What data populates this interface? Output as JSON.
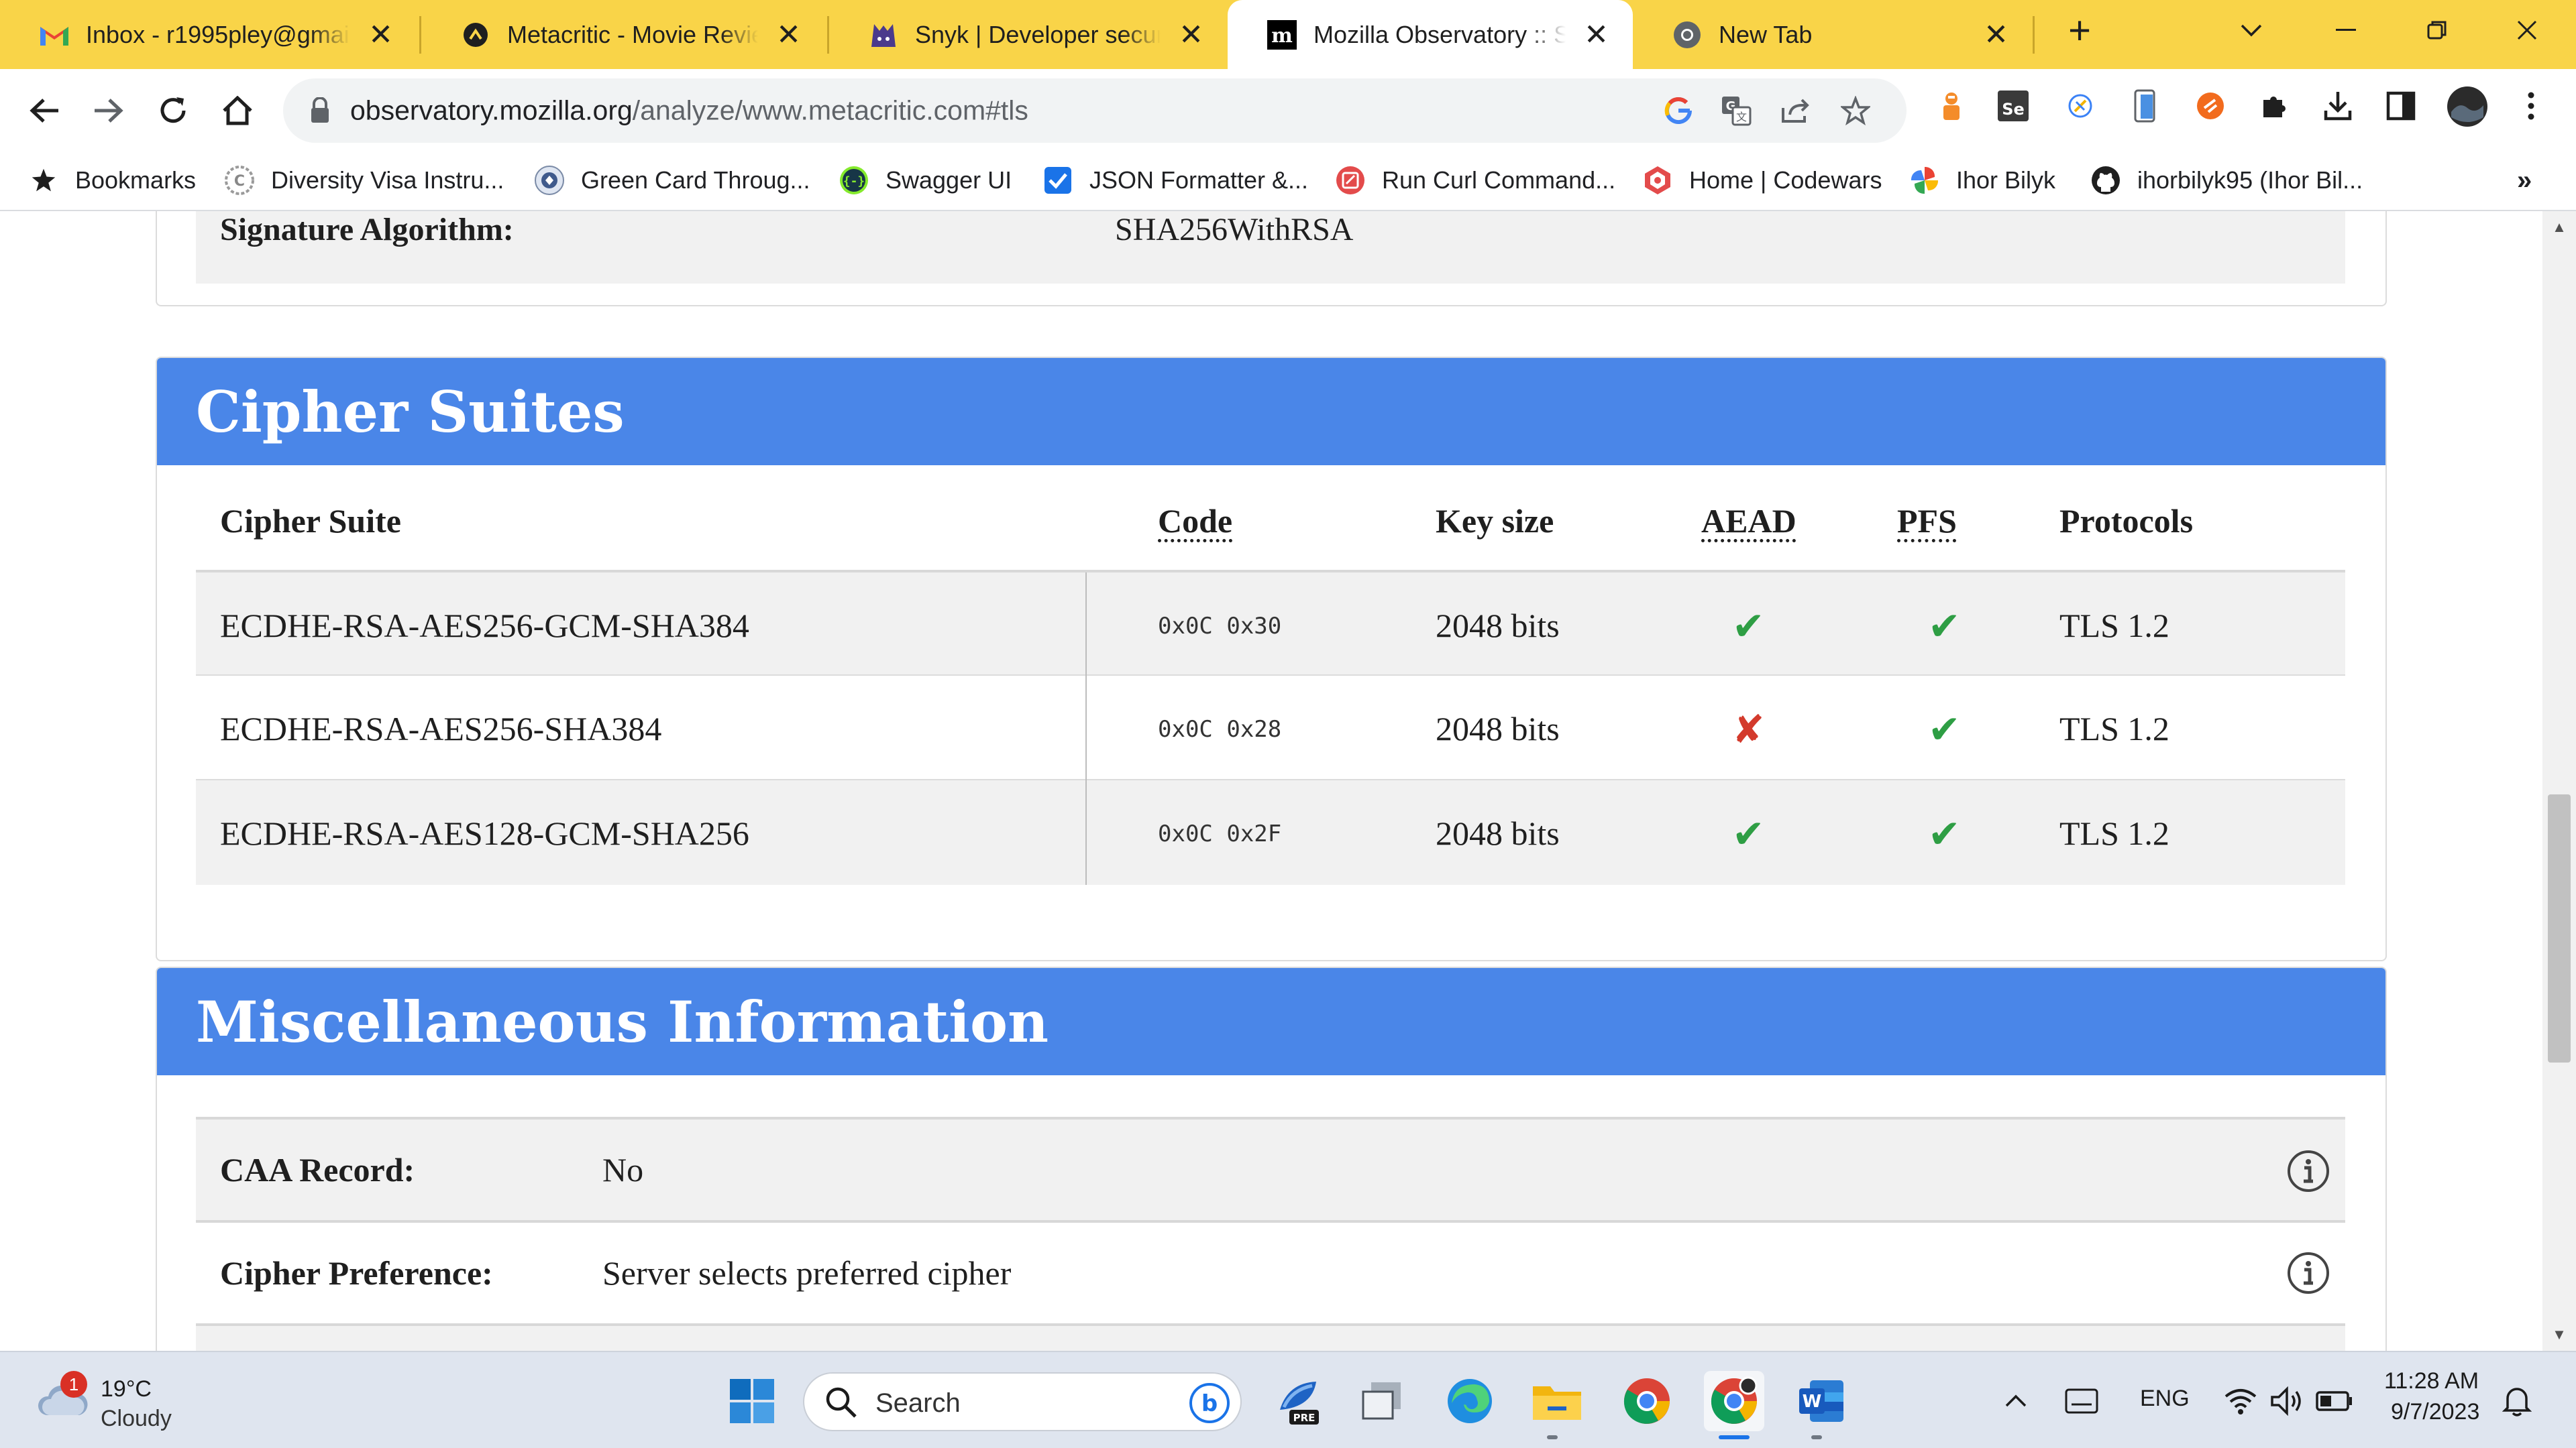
{
  "browser": {
    "tabs": [
      {
        "title": "Inbox - r1995pley@gmail.com",
        "icon": "gmail-icon"
      },
      {
        "title": "Metacritic - Movie Reviews",
        "icon": "metacritic-icon"
      },
      {
        "title": "Snyk | Developer security",
        "icon": "snyk-icon"
      },
      {
        "title": "Mozilla Observatory :: Scan",
        "icon": "mozilla-icon",
        "active": true
      },
      {
        "title": "New Tab",
        "icon": "chrome-icon"
      }
    ],
    "url_host": "observatory.mozilla.org",
    "url_path": "/analyze/www.metacritic.com#tls",
    "bookmarks": [
      {
        "label": "Bookmarks",
        "icon": "star-icon"
      },
      {
        "label": "Diversity Visa Instru...",
        "icon": "dv-icon"
      },
      {
        "label": "Green Card Throug...",
        "icon": "dhs-seal-icon"
      },
      {
        "label": "Swagger UI",
        "icon": "swagger-icon"
      },
      {
        "label": "JSON Formatter &...",
        "icon": "json-check-icon"
      },
      {
        "label": "Run Curl Command...",
        "icon": "curl-icon"
      },
      {
        "label": "Home | Codewars",
        "icon": "codewars-icon"
      },
      {
        "label": "Ihor Bilyk",
        "icon": "pinwheel-icon"
      },
      {
        "label": "ihorbilyk95 (Ihor Bil...",
        "icon": "github-icon"
      }
    ],
    "bookmarks_overflow": "»"
  },
  "page": {
    "top_row": {
      "label": "Signature Algorithm:",
      "value": "SHA256WithRSA"
    },
    "cipher": {
      "title": "Cipher Suites",
      "headers": {
        "suite": "Cipher Suite",
        "code": "Code",
        "keysize": "Key size",
        "aead": "AEAD",
        "pfs": "PFS",
        "protocols": "Protocols"
      },
      "rows": [
        {
          "suite": "ECDHE-RSA-AES256-GCM-SHA384",
          "code": "0x0C 0x30",
          "keysize": "2048 bits",
          "aead": "✔",
          "pfs": "✔",
          "protocols": "TLS 1.2"
        },
        {
          "suite": "ECDHE-RSA-AES256-SHA384",
          "code": "0x0C 0x28",
          "keysize": "2048 bits",
          "aead": "✘",
          "pfs": "✔",
          "protocols": "TLS 1.2"
        },
        {
          "suite": "ECDHE-RSA-AES128-GCM-SHA256",
          "code": "0x0C 0x2F",
          "keysize": "2048 bits",
          "aead": "✔",
          "pfs": "✔",
          "protocols": "TLS 1.2"
        }
      ]
    },
    "misc": {
      "title": "Miscellaneous Information",
      "rows": [
        {
          "label": "CAA Record:",
          "value": "No"
        },
        {
          "label": "Cipher Preference:",
          "value": "Server selects preferred cipher"
        }
      ]
    }
  },
  "taskbar": {
    "weather_temp": "19°C",
    "weather_desc": "Cloudy",
    "weather_badge": "1",
    "search_placeholder": "Search",
    "store_badge": "PRE",
    "lang": "ENG",
    "time": "11:28 AM",
    "date": "9/7/2023"
  },
  "colors": {
    "tabstrip": "#f9d448",
    "header_blue": "#4a86e8",
    "check_green": "#2e9e44",
    "cross_red": "#d33a2c"
  }
}
